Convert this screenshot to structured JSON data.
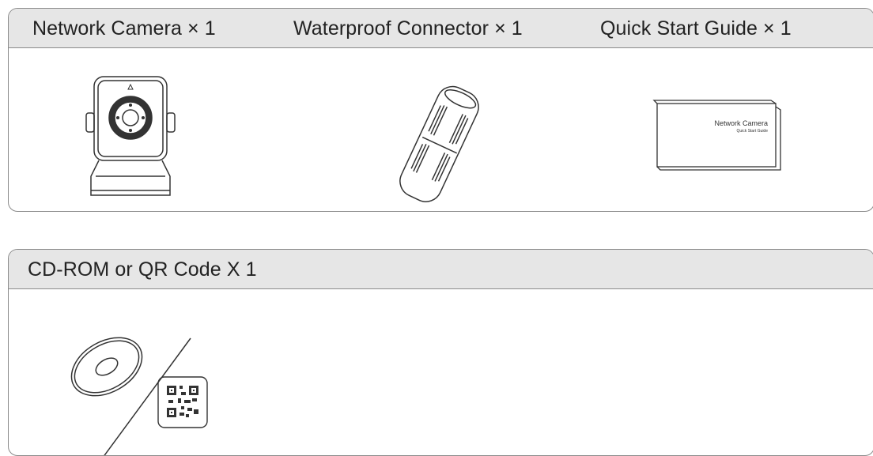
{
  "panel1": {
    "items": [
      {
        "label": "Network Camera × 1",
        "icon": "network-camera-icon"
      },
      {
        "label": "Waterproof Connector × 1",
        "icon": "waterproof-connector-icon"
      },
      {
        "label": "Quick Start Guide × 1",
        "icon": "quick-start-guide-icon"
      }
    ],
    "guide_cover_title": "Network Camera",
    "guide_cover_subtitle": "Quick Start Guide"
  },
  "panel2": {
    "title": "CD-ROM or QR Code X 1",
    "icons": [
      "cd-rom-icon",
      "qr-code-icon"
    ]
  },
  "colors": {
    "border": "#8a8a8a",
    "header_background": "#e6e6e6",
    "line_art": "#333333"
  }
}
